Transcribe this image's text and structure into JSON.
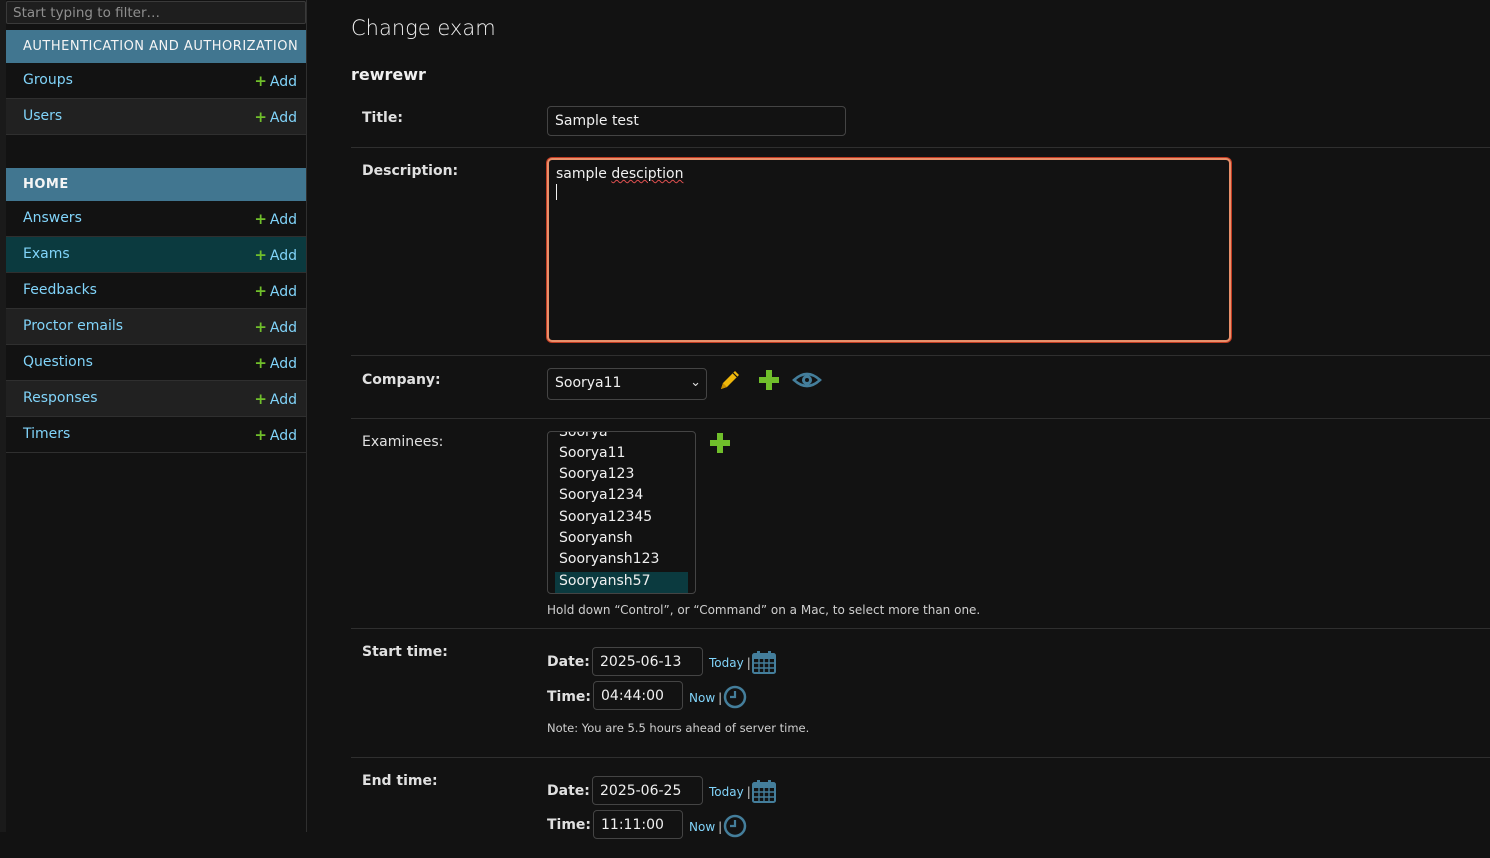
{
  "sidebar": {
    "filter_placeholder": "Start typing to filter…",
    "apps": [
      {
        "header": "AUTHENTICATION AND AUTHORIZATION",
        "models": [
          {
            "label": "Groups",
            "add": "Add"
          },
          {
            "label": "Users",
            "add": "Add"
          }
        ]
      },
      {
        "header": "HOME",
        "models": [
          {
            "label": "Answers",
            "add": "Add"
          },
          {
            "label": "Exams",
            "add": "Add",
            "active": true
          },
          {
            "label": "Feedbacks",
            "add": "Add"
          },
          {
            "label": "Proctor emails",
            "add": "Add"
          },
          {
            "label": "Questions",
            "add": "Add"
          },
          {
            "label": "Responses",
            "add": "Add"
          },
          {
            "label": "Timers",
            "add": "Add"
          }
        ]
      }
    ]
  },
  "main": {
    "page_title": "Change exam",
    "object_name": "rewrewr",
    "fields": {
      "title": {
        "label": "Title:",
        "value": "Sample test"
      },
      "description": {
        "label": "Description:",
        "value_word1": "sample",
        "value_word2": "desciption"
      },
      "company": {
        "label": "Company:",
        "selected": "Soorya11"
      },
      "examinees": {
        "label": "Examinees:",
        "options": [
          "Soorya",
          "Soorya11",
          "Soorya123",
          "Soorya1234",
          "Soorya12345",
          "Sooryansh",
          "Sooryansh123",
          "Sooryansh57"
        ],
        "selected": "Sooryansh57",
        "help": "Hold down “Control”, or “Command” on a Mac, to select more than one."
      },
      "start_time": {
        "label": "Start time:",
        "date_label": "Date:",
        "date": "2025-06-13",
        "today": "Today",
        "time_label": "Time:",
        "time": "04:44:00",
        "now": "Now",
        "note": "Note: You are 5.5 hours ahead of server time."
      },
      "end_time": {
        "label": "End time:",
        "date_label": "Date:",
        "date": "2025-06-25",
        "today": "Today",
        "time_label": "Time:",
        "time": "11:11:00",
        "now": "Now"
      }
    }
  },
  "colors": {
    "app_header": "#417690",
    "link": "#81d4fa",
    "add_green": "#70bf2b",
    "active_row": "#0b3a3f",
    "focus_border": "#e8906b",
    "edit_icon": "#efb80b",
    "view_icon": "#447e9b"
  },
  "icons": {
    "add": "plus-icon",
    "edit": "pencil-icon",
    "view": "eye-icon",
    "calendar": "calendar-icon",
    "clock": "clock-icon",
    "dropdown": "chevron-down-icon"
  }
}
